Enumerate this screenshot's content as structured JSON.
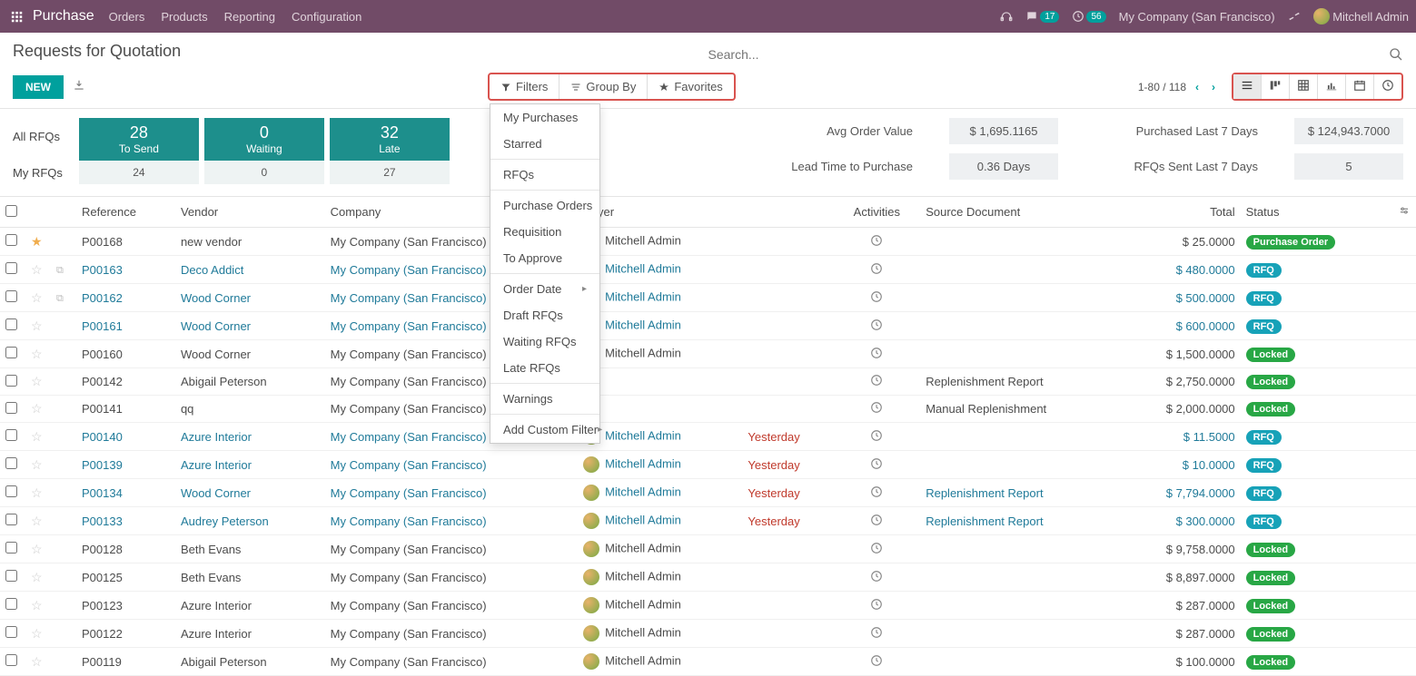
{
  "nav": {
    "brand": "Purchase",
    "menu": [
      "Orders",
      "Products",
      "Reporting",
      "Configuration"
    ],
    "chat_count": "17",
    "clock_count": "56",
    "company": "My Company (San Francisco)",
    "user": "Mitchell Admin"
  },
  "page": {
    "title": "Requests for Quotation",
    "new_btn": "NEW",
    "search_placeholder": "Search..."
  },
  "filters": {
    "filters_label": "Filters",
    "groupby_label": "Group By",
    "favorites_label": "Favorites",
    "dropdown": [
      [
        "My Purchases",
        "Starred"
      ],
      [
        "RFQs"
      ],
      [
        "Purchase Orders",
        "Requisition",
        "To Approve"
      ],
      [
        "Order Date",
        "Draft RFQs",
        "Waiting RFQs",
        "Late RFQs"
      ],
      [
        "Warnings"
      ],
      [
        "Add Custom Filter"
      ]
    ],
    "dropdown_submenus": {
      "Order Date": true,
      "Add Custom Filter": true
    }
  },
  "pager": {
    "range": "1-80 / 118"
  },
  "dash": {
    "all_label": "All RFQs",
    "my_label": "My RFQs",
    "tiles": [
      {
        "value": "28",
        "label": "To Send",
        "my": "24"
      },
      {
        "value": "0",
        "label": "Waiting",
        "my": "0"
      },
      {
        "value": "32",
        "label": "Late",
        "my": "27"
      }
    ],
    "kpis": [
      {
        "label": "Avg Order Value",
        "value": "$ 1,695.1165"
      },
      {
        "label": "Purchased Last 7 Days",
        "value": "$ 124,943.7000"
      },
      {
        "label": "Lead Time to Purchase",
        "value": "0.36 Days"
      },
      {
        "label": "RFQs Sent Last 7 Days",
        "value": "5"
      }
    ]
  },
  "columns": {
    "reference": "Reference",
    "vendor": "Vendor",
    "company": "Company",
    "buyer": "Buyer",
    "activities": "Activities",
    "source": "Source Document",
    "total": "Total",
    "status": "Status"
  },
  "rows": [
    {
      "fav": true,
      "copy": false,
      "link": false,
      "ref": "P00168",
      "vendor": "new vendor",
      "company": "My Company (San Francisco)",
      "buyer": "Mitchell Admin",
      "deadline": "",
      "activity": "clock",
      "source": "",
      "total": "$ 25.0000",
      "status": "Purchase Order",
      "status_class": "status-po"
    },
    {
      "fav": false,
      "copy": true,
      "link": true,
      "ref": "P00163",
      "vendor": "Deco Addict",
      "company": "My Company (San Francisco)",
      "buyer": "Mitchell Admin",
      "deadline": "",
      "activity": "clock",
      "source": "",
      "total": "$ 480.0000",
      "status": "RFQ",
      "status_class": "status-rfq"
    },
    {
      "fav": false,
      "copy": true,
      "link": true,
      "ref": "P00162",
      "vendor": "Wood Corner",
      "company": "My Company (San Francisco)",
      "buyer": "Mitchell Admin",
      "deadline": "",
      "activity": "clock",
      "source": "",
      "total": "$ 500.0000",
      "status": "RFQ",
      "status_class": "status-rfq"
    },
    {
      "fav": false,
      "copy": false,
      "link": true,
      "ref": "P00161",
      "vendor": "Wood Corner",
      "company": "My Company (San Francisco)",
      "buyer": "Mitchell Admin",
      "deadline": "",
      "activity": "clock",
      "source": "",
      "total": "$ 600.0000",
      "status": "RFQ",
      "status_class": "status-rfq"
    },
    {
      "fav": false,
      "copy": false,
      "link": false,
      "ref": "P00160",
      "vendor": "Wood Corner",
      "company": "My Company (San Francisco)",
      "buyer": "Mitchell Admin",
      "deadline": "",
      "activity": "clock",
      "source": "",
      "total": "$ 1,500.0000",
      "status": "Locked",
      "status_class": "status-locked"
    },
    {
      "fav": false,
      "copy": false,
      "link": false,
      "ref": "P00142",
      "vendor": "Abigail Peterson",
      "company": "My Company (San Francisco)",
      "buyer": "",
      "deadline": "",
      "activity": "clock",
      "source": "Replenishment Report",
      "total": "$ 2,750.0000",
      "status": "Locked",
      "status_class": "status-locked"
    },
    {
      "fav": false,
      "copy": false,
      "link": false,
      "ref": "P00141",
      "vendor": "qq",
      "company": "My Company (San Francisco)",
      "buyer": "",
      "deadline": "",
      "activity": "clock",
      "source": "Manual Replenishment",
      "total": "$ 2,000.0000",
      "status": "Locked",
      "status_class": "status-locked"
    },
    {
      "fav": false,
      "copy": false,
      "link": true,
      "ref": "P00140",
      "vendor": "Azure Interior",
      "company": "My Company (San Francisco)",
      "buyer": "Mitchell Admin",
      "deadline": "Yesterday",
      "activity": "clock",
      "source": "",
      "total": "$ 11.5000",
      "status": "RFQ",
      "status_class": "status-rfq"
    },
    {
      "fav": false,
      "copy": false,
      "link": true,
      "ref": "P00139",
      "vendor": "Azure Interior",
      "company": "My Company (San Francisco)",
      "buyer": "Mitchell Admin",
      "deadline": "Yesterday",
      "activity": "clock",
      "source": "",
      "total": "$ 10.0000",
      "status": "RFQ",
      "status_class": "status-rfq"
    },
    {
      "fav": false,
      "copy": false,
      "link": true,
      "ref": "P00134",
      "vendor": "Wood Corner",
      "company": "My Company (San Francisco)",
      "buyer": "Mitchell Admin",
      "deadline": "Yesterday",
      "activity": "clock",
      "source": "Replenishment Report",
      "source_link": true,
      "total": "$ 7,794.0000",
      "status": "RFQ",
      "status_class": "status-rfq"
    },
    {
      "fav": false,
      "copy": false,
      "link": true,
      "ref": "P00133",
      "vendor": "Audrey Peterson",
      "company": "My Company (San Francisco)",
      "buyer": "Mitchell Admin",
      "deadline": "Yesterday",
      "activity": "clock",
      "source": "Replenishment Report",
      "source_link": true,
      "total": "$ 300.0000",
      "status": "RFQ",
      "status_class": "status-rfq"
    },
    {
      "fav": false,
      "copy": false,
      "link": false,
      "ref": "P00128",
      "vendor": "Beth Evans",
      "company": "My Company (San Francisco)",
      "buyer": "Mitchell Admin",
      "deadline": "",
      "activity": "clock",
      "source": "",
      "total": "$ 9,758.0000",
      "status": "Locked",
      "status_class": "status-locked"
    },
    {
      "fav": false,
      "copy": false,
      "link": false,
      "ref": "P00125",
      "vendor": "Beth Evans",
      "company": "My Company (San Francisco)",
      "buyer": "Mitchell Admin",
      "deadline": "",
      "activity": "clock",
      "source": "",
      "total": "$ 8,897.0000",
      "status": "Locked",
      "status_class": "status-locked"
    },
    {
      "fav": false,
      "copy": false,
      "link": false,
      "ref": "P00123",
      "vendor": "Azure Interior",
      "company": "My Company (San Francisco)",
      "buyer": "Mitchell Admin",
      "deadline": "",
      "activity": "clock",
      "source": "",
      "total": "$ 287.0000",
      "status": "Locked",
      "status_class": "status-locked"
    },
    {
      "fav": false,
      "copy": false,
      "link": false,
      "ref": "P00122",
      "vendor": "Azure Interior",
      "company": "My Company (San Francisco)",
      "buyer": "Mitchell Admin",
      "deadline": "",
      "activity": "clock",
      "source": "",
      "total": "$ 287.0000",
      "status": "Locked",
      "status_class": "status-locked"
    },
    {
      "fav": false,
      "copy": false,
      "link": false,
      "ref": "P00119",
      "vendor": "Abigail Peterson",
      "company": "My Company (San Francisco)",
      "buyer": "Mitchell Admin",
      "deadline": "",
      "activity": "clock",
      "source": "",
      "total": "$ 100.0000",
      "status": "Locked",
      "status_class": "status-locked"
    }
  ]
}
